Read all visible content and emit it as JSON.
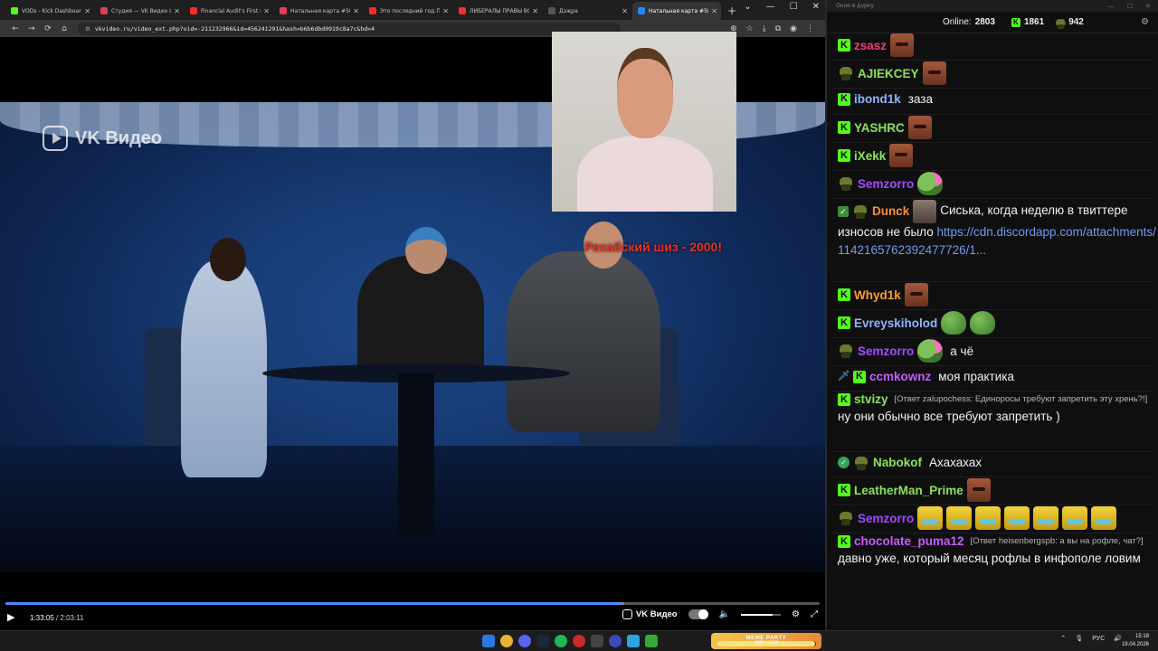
{
  "browser": {
    "tabs": [
      {
        "title": "VODs - Kick Dashboard",
        "color": "#53fc18",
        "active": false
      },
      {
        "title": "Студия — VK Видео Live",
        "color": "#e43b5c",
        "active": false
      },
      {
        "title": "Financial Audit's First F",
        "color": "#ff2a2a",
        "active": false
      },
      {
        "title": "Натальная карта #58 | ",
        "color": "#e43b5c",
        "active": false
      },
      {
        "title": "Это последний год Пу",
        "color": "#ff2a2a",
        "active": false
      },
      {
        "title": "ЛИБЕРАЛЫ ПРАВЫ ВС",
        "color": "#ff2a2a",
        "active": false
      },
      {
        "title": "Дзҗра",
        "color": "#555555",
        "active": false
      },
      {
        "title": "Натальная карта #58 | ",
        "color": "#2787f5",
        "active": true
      }
    ],
    "new_tab": "+",
    "window_controls": [
      "⌄",
      "—",
      "☐",
      "✕"
    ],
    "url": "vkvideo.ru/video_ext.php?oid=-211232966&id=456241291&hash=b6b6dbd0919c8a7c&hd=4"
  },
  "video": {
    "watermark": "VK Видео",
    "overlay": "Рехабский шиз  - 2000!",
    "current_time": "1:33:05",
    "duration": "2:03:11",
    "progress_fraction": 0.755,
    "buffer_fraction": 0.76,
    "volume_fraction": 0.8,
    "brand_label": "VK Видео"
  },
  "chat": {
    "window_title": "Окно в дурку",
    "online_label": "Online:",
    "online_count": "2803",
    "stat_kick": "1861",
    "stat_other": "942",
    "messages": [
      {
        "user": "zsasz",
        "color": "#f23a75",
        "text": ""
      },
      {
        "user": "AJIEKCEY",
        "color": "#8ce25c",
        "text": ""
      },
      {
        "user": "ibond1k",
        "color": "#8eb5ff",
        "text": "заза"
      },
      {
        "user": "YASHRC",
        "color": "#8ce25c",
        "text": ""
      },
      {
        "user": "iXekk",
        "color": "#8ce25c",
        "text": ""
      },
      {
        "user": "Semzorro",
        "color": "#a24cff",
        "text": ""
      },
      {
        "user": "Dunck",
        "color": "#ff8c3a",
        "text": "Сиська, когда неделю в твиттере износов не было",
        "link": "https://cdn.discordapp.com/attachments/1142165762392477726/1..."
      },
      {
        "user": "Whyd1k",
        "color": "#ff9d2a",
        "text": ""
      },
      {
        "user": "Evreyskiholod",
        "color": "#8eb5ff",
        "text": ""
      },
      {
        "user": "Semzorro",
        "color": "#a24cff",
        "text": "а чё"
      },
      {
        "user": "ccmkownz",
        "color": "#c55dff",
        "text": "моя практика"
      },
      {
        "user": "stvizy",
        "color": "#8ce25c",
        "reply": "[Ответ zalupochess: Единоросы требуют запретить эту хрень?!]",
        "text": "ну они обычно все требуют запретить )"
      },
      {
        "user": "Nabokof",
        "color": "#8ce25c",
        "text": "Ахахахах"
      },
      {
        "user": "LeatherMan_Prime",
        "color": "#8ce25c",
        "text": ""
      },
      {
        "user": "Semzorro",
        "color": "#a24cff",
        "text": ""
      },
      {
        "user": "chocolate_puma12",
        "color": "#c55dff",
        "reply": "[Ответ heisenbergspb: а вы на рофле, чат?]",
        "text": "давно уже, который месяц рофлы в инфополе ловим"
      }
    ]
  },
  "taskbar": {
    "meme_title": "MEME PARTY",
    "meme_progress": "1487 / 1500",
    "meme_fraction": 0.99,
    "lang": "РУС",
    "time": "15:18",
    "date": "19.04.2026"
  }
}
